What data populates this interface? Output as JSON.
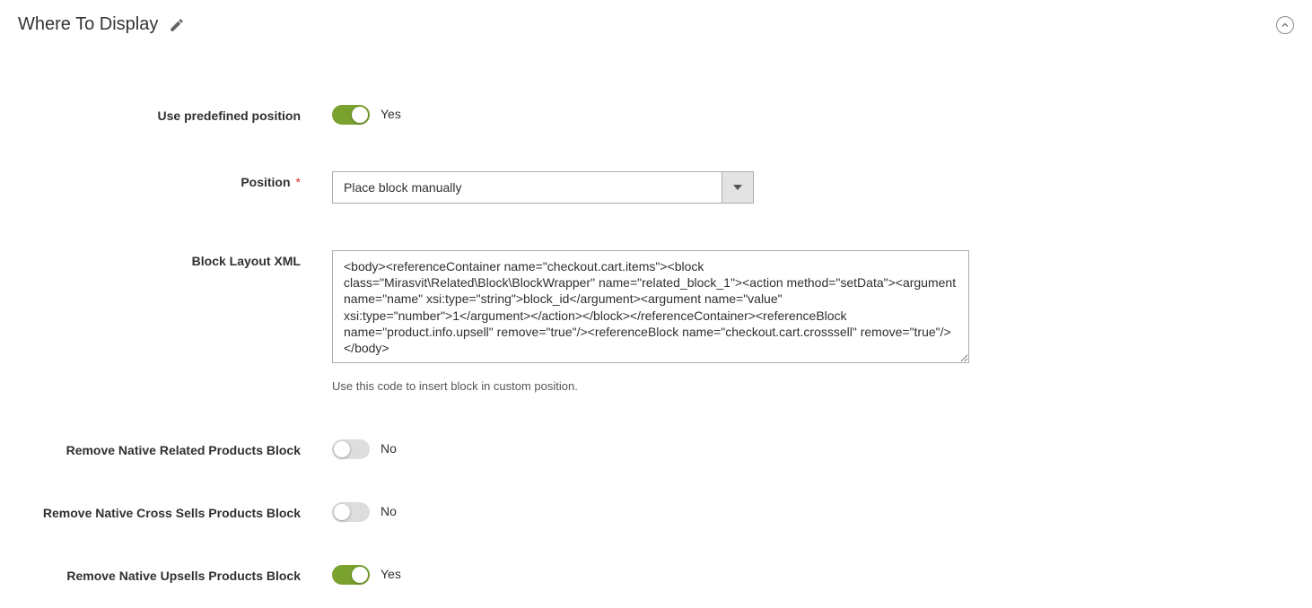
{
  "section": {
    "title": "Where To Display"
  },
  "fields": {
    "predefined": {
      "label": "Use predefined position",
      "on": true,
      "text_on": "Yes",
      "text_off": "No"
    },
    "position": {
      "label": "Position",
      "required_mark": "*",
      "value": "Place block manually"
    },
    "xml": {
      "label": "Block Layout XML",
      "value": "<body><referenceContainer name=\"checkout.cart.items\"><block class=\"Mirasvit\\Related\\Block\\BlockWrapper\" name=\"related_block_1\"><action method=\"setData\"><argument name=\"name\" xsi:type=\"string\">block_id</argument><argument name=\"value\" xsi:type=\"number\">1</argument></action></block></referenceContainer><referenceBlock name=\"product.info.upsell\" remove=\"true\"/><referenceBlock name=\"checkout.cart.crosssell\" remove=\"true\"/></body>",
      "hint": "Use this code to insert block in custom position."
    },
    "remove_related": {
      "label": "Remove Native Related Products Block",
      "on": false,
      "text_on": "Yes",
      "text_off": "No"
    },
    "remove_cross": {
      "label": "Remove Native Cross Sells Products Block",
      "on": false,
      "text_on": "Yes",
      "text_off": "No"
    },
    "remove_upsell": {
      "label": "Remove Native Upsells Products Block",
      "on": true,
      "text_on": "Yes",
      "text_off": "No"
    }
  }
}
